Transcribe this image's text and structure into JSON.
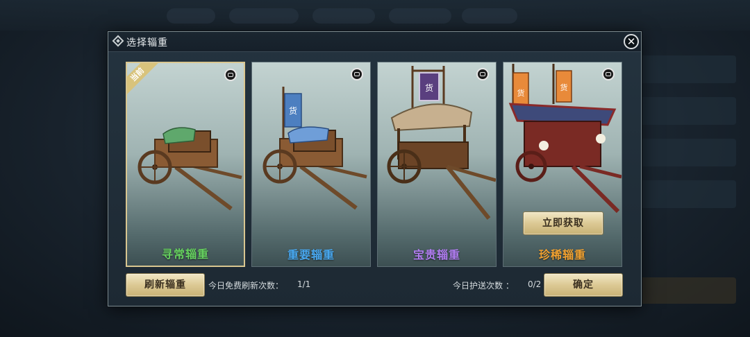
{
  "dialog": {
    "title": "选择辎重",
    "close_symbol": "✕"
  },
  "cards": [
    {
      "label": "寻常辎重",
      "color": "#66d15f",
      "selected": true,
      "badge": "当前"
    },
    {
      "label": "重要辎重",
      "color": "#48a8f0",
      "flag_char": "货"
    },
    {
      "label": "宝贵辎重",
      "color": "#b07cf0",
      "flag_char": "货"
    },
    {
      "label": "珍稀辎重",
      "color": "#f0a030",
      "flag_char": "货",
      "action_label": "立即获取"
    }
  ],
  "footer": {
    "refresh_button": "刷新辎重",
    "free_refresh_label": "今日免费刷新次数：",
    "free_refresh_value": "1/1",
    "escort_label": "今日护送次数 ：",
    "escort_value": "0/2",
    "confirm_button": "确定"
  }
}
